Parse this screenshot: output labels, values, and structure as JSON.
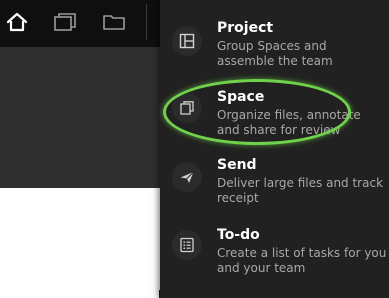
{
  "toolbar": {
    "icons": [
      "home-icon",
      "layers-icon",
      "folder-icon"
    ]
  },
  "menu": {
    "items": [
      {
        "title": "Project",
        "description": "Group Spaces and assemble the team",
        "icon": "project-icon"
      },
      {
        "title": "Space",
        "description": "Organize files, annotate and share for review",
        "icon": "space-icon"
      },
      {
        "title": "Send",
        "description": "Deliver large files and track receipt",
        "icon": "send-icon"
      },
      {
        "title": "To-do",
        "description": "Create a list of tasks for you and your team",
        "icon": "todo-icon"
      }
    ]
  },
  "colors": {
    "toolbar_bg": "#0f0f0f",
    "menu_bg": "#212121",
    "highlight": "#6fd24a"
  }
}
